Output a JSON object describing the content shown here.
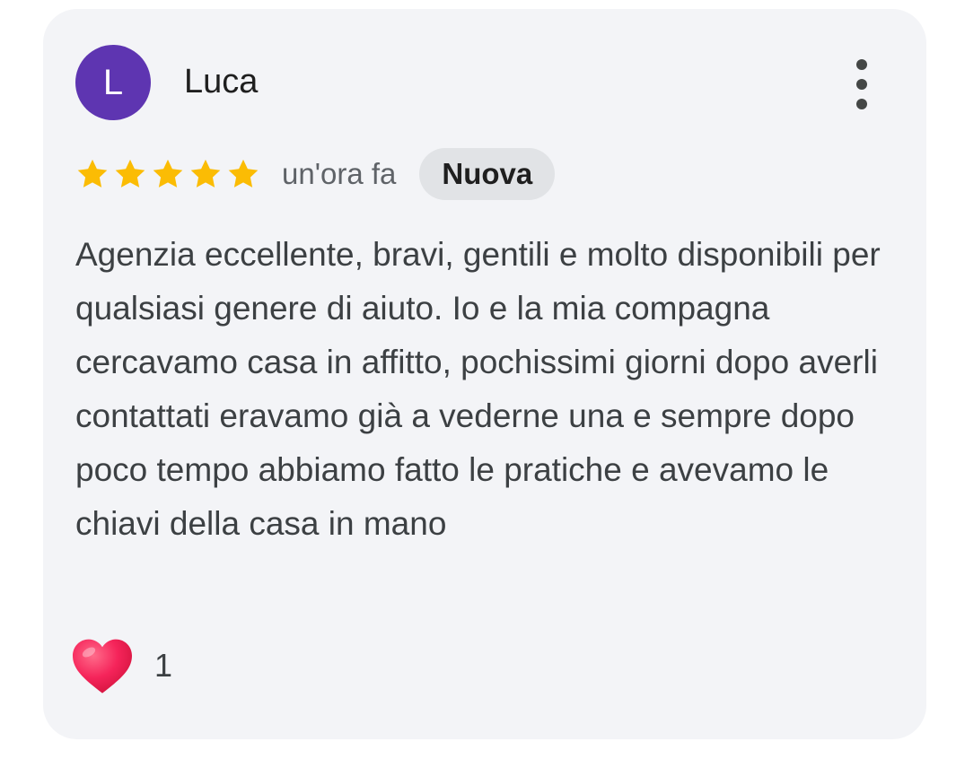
{
  "review": {
    "author": "Luca",
    "avatar_initial": "L",
    "avatar_color": "#5e35b1",
    "menu_icon": "more-vert-icon",
    "rating": 5,
    "rating_max": 5,
    "star_color": "#fbbc04",
    "time": "un'ora fa",
    "badge": "Nuova",
    "text": "Agenzia eccellente, bravi, gentili e molto disponibili per qualsiasi genere di aiuto. Io e la mia compagna cercavamo casa in affitto, pochissimi giorni dopo averli contattati eravamo già a vederne una e sempre dopo poco tempo abbiamo fatto le pratiche e avevamo le chiavi della casa in mano",
    "reaction": {
      "icon": "heart-icon",
      "count": "1"
    }
  }
}
